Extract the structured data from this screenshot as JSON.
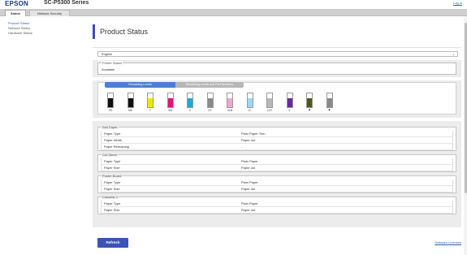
{
  "header": {
    "brand": "EPSON",
    "model": "SC-P5300 Series",
    "login": "Log in"
  },
  "tabs": [
    {
      "label": "Status"
    },
    {
      "label": "Network Security"
    }
  ],
  "sidebar": {
    "items": [
      {
        "label": "Product Status"
      },
      {
        "label": "Network Status"
      },
      {
        "label": "Hardware Status"
      }
    ]
  },
  "main": {
    "title": "Product Status",
    "language": "English",
    "printer_status": {
      "legend": "Printer Status",
      "value": "Available"
    }
  },
  "ink": {
    "tabs": [
      {
        "label": "Remaining Levels"
      },
      {
        "label": "Remaining Levels and Part Numbers"
      }
    ],
    "cartridges": [
      {
        "label": "PK",
        "color": "#111111",
        "level": 0.65
      },
      {
        "label": "MK",
        "color": "#111111",
        "level": 0.65
      },
      {
        "label": "Y",
        "color": "#f2e600",
        "level": 0.65
      },
      {
        "label": "VM",
        "color": "#e0147a",
        "level": 0.65
      },
      {
        "label": "C",
        "color": "#1aa9e0",
        "level": 0.65
      },
      {
        "label": "GY",
        "color": "#8a8a8a",
        "level": 0.65
      },
      {
        "label": "VLM",
        "color": "#f0a6cf",
        "level": 0.65
      },
      {
        "label": "LC",
        "color": "#9ad7f2",
        "level": 0.65
      },
      {
        "label": "LGY",
        "color": "#b8b8b8",
        "level": 0.65
      },
      {
        "label": "V",
        "color": "#6a2a9c",
        "level": 0.65
      },
      {
        "label": "",
        "mark": "▲",
        "color": "#4a5a1a",
        "level": 0.65
      },
      {
        "label": "",
        "mark": "▲",
        "color": "#8a8a8a",
        "level": 0.65
      }
    ]
  },
  "paper": {
    "groups": [
      {
        "legend": "Roll Paper",
        "rows": [
          {
            "key": "Paper Type",
            "value": "Plain Paper Thin"
          },
          {
            "key": "Paper Width",
            "value": "Paper out"
          },
          {
            "key": "Paper Remaining",
            "value": "-"
          }
        ]
      },
      {
        "legend": "Cut Sheet",
        "rows": [
          {
            "key": "Paper Type",
            "value": "Plain Paper"
          },
          {
            "key": "Paper Size",
            "value": "Paper out"
          }
        ]
      },
      {
        "legend": "Poster Board",
        "rows": [
          {
            "key": "Paper Type",
            "value": "Plain Paper"
          },
          {
            "key": "Paper Size",
            "value": "Paper out"
          }
        ]
      },
      {
        "legend": "Cassette 1",
        "rows": [
          {
            "key": "Paper Type",
            "value": "Plain Paper"
          },
          {
            "key": "Paper Size",
            "value": "Paper out"
          }
        ]
      }
    ]
  },
  "footer": {
    "refresh": "Refresh",
    "license": "Software Licenses"
  }
}
